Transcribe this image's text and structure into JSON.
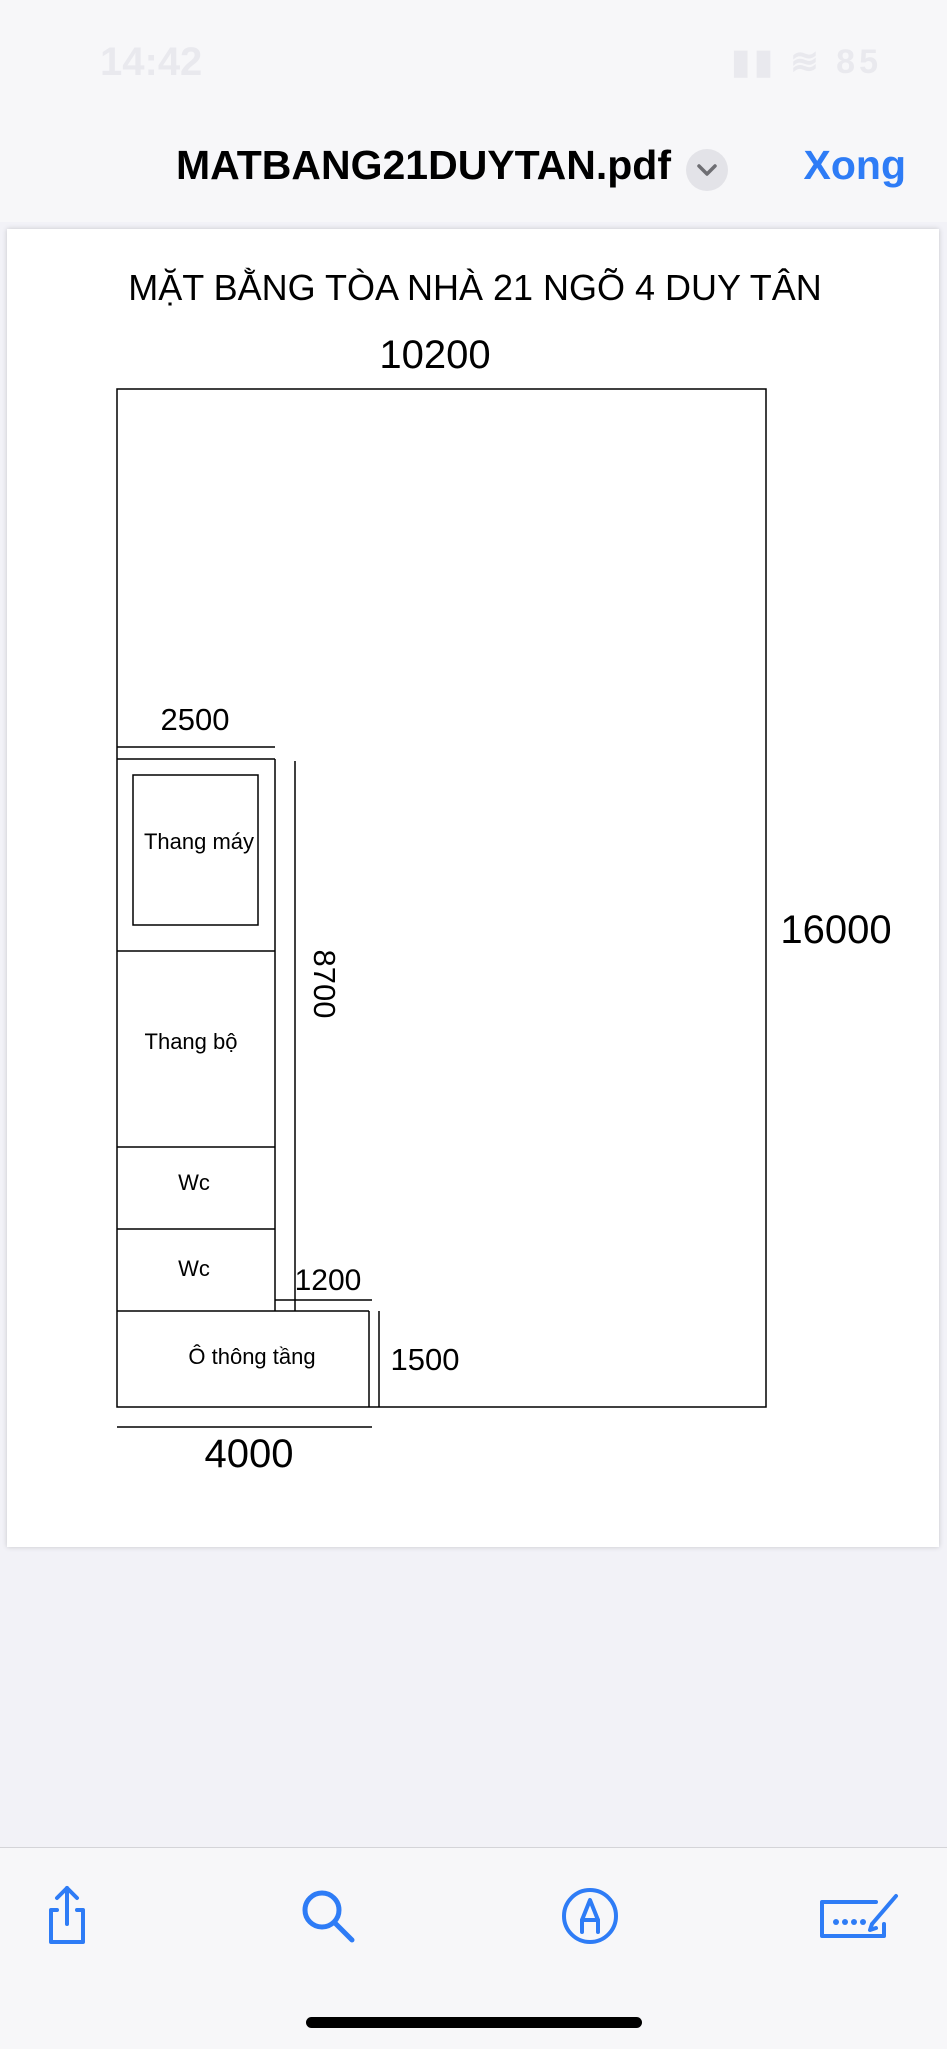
{
  "status_bar": {
    "time": "14:42",
    "indicators": "▮▮ ≋ 85"
  },
  "nav": {
    "title": "MATBANG21DUYTAN.pdf",
    "done_label": "Xong",
    "chevron_icon": "chevron-down-icon"
  },
  "floor_plan": {
    "title": "MẶT BẰNG TÒA NHÀ 21 NGÕ 4 DUY TÂN",
    "dim_width": "10200",
    "dim_height": "16000",
    "dim_core_width": "2500",
    "dim_core_height": "8700",
    "dim_gap": "1200",
    "dim_shaft_height": "1500",
    "dim_bottom": "4000",
    "rooms": {
      "elevator": "Thang máy",
      "stairs": "Thang bộ",
      "wc_1": "Wc",
      "wc_2": "Wc",
      "shaft": "Ô thông tầng"
    }
  },
  "toolbar": {
    "share_icon": "share-icon",
    "search_icon": "search-icon",
    "markup_icon": "markup-icon",
    "signature_icon": "signature-icon"
  },
  "colors": {
    "accent": "#2e7cf6",
    "background": "#f2f2f7",
    "line": "#000000"
  }
}
